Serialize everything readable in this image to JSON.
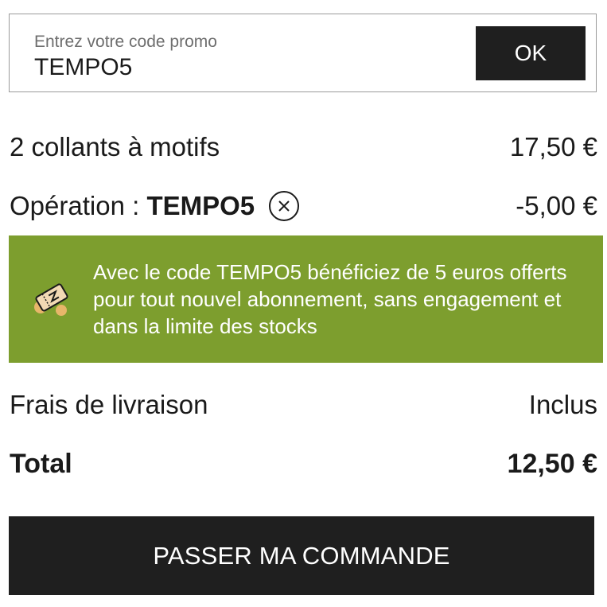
{
  "promo": {
    "placeholder": "Entrez votre code promo",
    "value": "TEMPO5",
    "ok_label": "OK"
  },
  "items": [
    {
      "label": "2 collants à motifs",
      "price": "17,50 €"
    }
  ],
  "discount": {
    "label_prefix": "Opération : ",
    "code": "TEMPO5",
    "amount": "-5,00 €",
    "remove_icon": "close-circle-icon"
  },
  "banner": {
    "icon": "promo-ticket-icon",
    "text": "Avec le code TEMPO5 bénéficiez de 5 euros offerts pour tout nouvel abonnement, sans engagement et dans la limite des stocks",
    "background": "#7d9e2e"
  },
  "shipping": {
    "label": "Frais de livraison",
    "value": "Inclus"
  },
  "total": {
    "label": "Total",
    "value": "12,50 €"
  },
  "cta": {
    "label": "PASSER MA COMMANDE"
  }
}
